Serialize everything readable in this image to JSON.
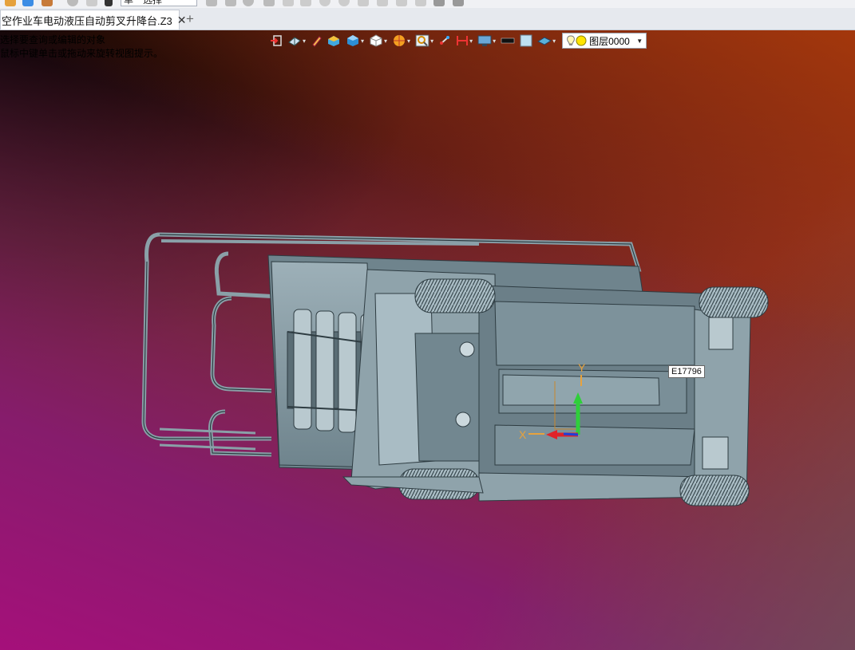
{
  "top_toolbar": {
    "filter_value": "单一选择"
  },
  "tab_bar": {
    "document_title": "空作业车电动液压自动剪叉升降台.Z3",
    "close_symbol": "✕",
    "add_symbol": "+"
  },
  "viewport": {
    "hint_line_1": "选择要查询或编辑的对象",
    "hint_line_2": "鼠标中键单击或拖动来旋转视图提示。",
    "layer": {
      "name": "图层0000"
    },
    "entity_tag": "E17796",
    "triad": {
      "x_label": "X",
      "y_label": "Y",
      "x_color": "#e0222a",
      "y_color": "#2fcf3a",
      "z_color": "#1f3fd8"
    },
    "background": {
      "top_left": "#000000",
      "top_right": "#b0370c",
      "bottom_left": "#a3107a",
      "bottom_right": "#6e4f5c"
    },
    "model_color": "#7e939c"
  },
  "view_toolbar_icons": [
    "exit-sketch-icon",
    "view-orient-icon",
    "pencil-icon",
    "shaded-box-icon",
    "box-blue-icon",
    "box-white-icon",
    "render-sphere-icon",
    "zoom-icon",
    "pan-icon",
    "measure-icon",
    "display-settings-icon",
    "black-rect-icon",
    "blue-rect-icon",
    "plane-icon"
  ]
}
